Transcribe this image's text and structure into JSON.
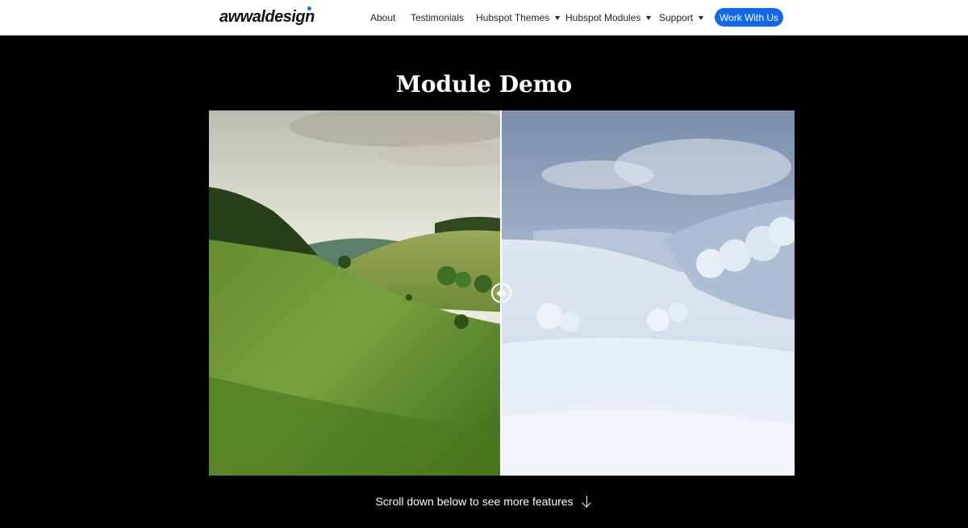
{
  "header": {
    "logo": "awwaldesign",
    "nav": [
      {
        "label": "About",
        "has_caret": false
      },
      {
        "label": "Testimonials",
        "has_caret": false
      },
      {
        "label": "Hubspot Themes",
        "has_caret": true
      },
      {
        "label": "Hubspot Modules",
        "has_caret": true
      },
      {
        "label": "Support",
        "has_caret": true
      }
    ],
    "cta_label": "Work With Us"
  },
  "main": {
    "title": "Module Demo",
    "comparison": {
      "left_image": "summer-landscape",
      "right_image": "winter-landscape",
      "slider_position": 0.5
    },
    "scroll_hint": "Scroll down below to see more features"
  },
  "colors": {
    "accent": "#1167ee",
    "background": "#000000",
    "header_background": "#ffffff"
  }
}
